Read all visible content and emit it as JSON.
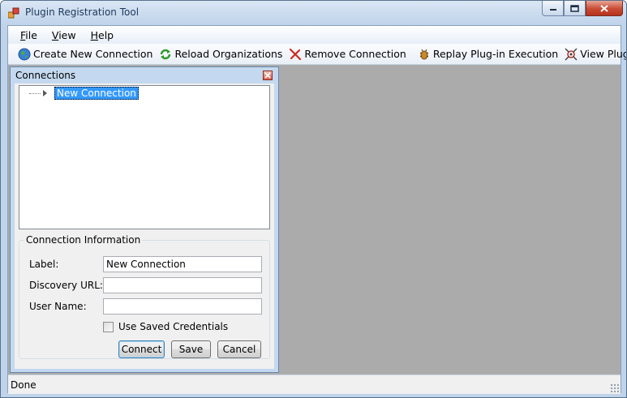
{
  "window": {
    "title": "Plugin Registration Tool"
  },
  "menu": [
    {
      "mnemonic": "F",
      "rest": "ile"
    },
    {
      "mnemonic": "V",
      "rest": "iew"
    },
    {
      "mnemonic": "H",
      "rest": "elp"
    }
  ],
  "toolbar": {
    "create_new_connection": "Create New Connection",
    "reload_organizations": "Reload Organizations",
    "remove_connection": "Remove Connection",
    "replay_plugin_execution": "Replay Plug-in Execution",
    "view_plugin_profile": "View Plug-in Profile"
  },
  "connections_panel": {
    "title": "Connections",
    "tree": [
      {
        "label": "New Connection",
        "selected": true
      }
    ]
  },
  "connection_info": {
    "legend": "Connection Information",
    "label_caption": "Label:",
    "label_value": "New Connection",
    "discovery_url_caption": "Discovery URL:",
    "discovery_url_value": "",
    "user_name_caption": "User Name:",
    "user_name_value": "",
    "use_saved_credentials": "Use Saved Credentials",
    "use_saved_credentials_checked": false,
    "connect_button": "Connect",
    "save_button": "Save",
    "cancel_button": "Cancel"
  },
  "status": {
    "text": "Done"
  },
  "colors": {
    "mdi_background": "#ababab",
    "selection": "#3399ff",
    "panel_frame": "#c4d9ef"
  }
}
